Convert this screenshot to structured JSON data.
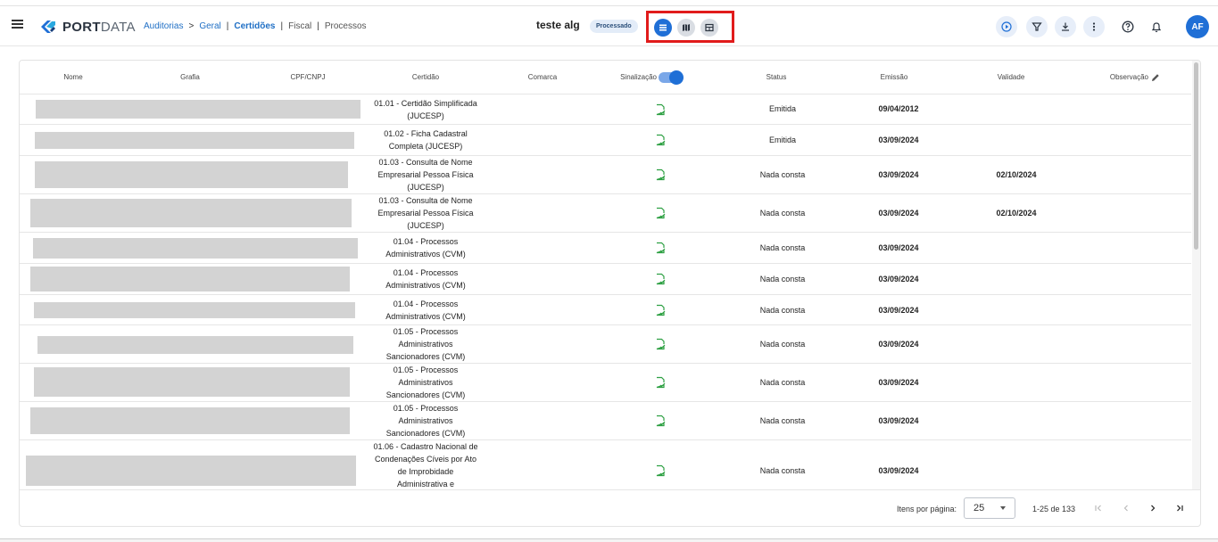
{
  "header": {
    "logo_strong": "PORT",
    "logo_light": "DATA",
    "breadcrumb": [
      {
        "label": "Auditorias"
      },
      {
        "label": ">"
      },
      {
        "label": "Geral"
      },
      {
        "label": "|"
      },
      {
        "label": "Certidões"
      },
      {
        "label": "|"
      },
      {
        "label": "Fiscal"
      },
      {
        "label": "|"
      },
      {
        "label": "Processos"
      }
    ],
    "doc_title": "teste alg",
    "status_chip": "Processado",
    "avatar_initials": "AF",
    "icons": [
      "menu-icon",
      "play-circle-icon",
      "filter-icon",
      "download-icon",
      "more-vert-icon",
      "help-icon",
      "bell-icon"
    ],
    "view_icons": [
      "list-view-icon",
      "map-view-icon",
      "table-view-icon"
    ]
  },
  "table": {
    "columns": {
      "nome": "Nome",
      "grafia": "Grafia",
      "cpf": "CPF/CNPJ",
      "certidao": "Certidão",
      "comarca": "Comarca",
      "sinalizacao": "Sinalização",
      "status": "Status",
      "emissao": "Emissão",
      "validade": "Validade",
      "observacao": "Observação"
    },
    "rows": [
      {
        "cert": "01.01 - Certidão Simplificada (JUCESP)",
        "status": "Emitida",
        "emissao": "09/04/2012",
        "validade": ""
      },
      {
        "cert": "01.02 - Ficha Cadastral Completa (JUCESP)",
        "status": "Emitida",
        "emissao": "03/09/2024",
        "validade": ""
      },
      {
        "cert": "01.03 - Consulta de Nome Empresarial Pessoa Física (JUCESP)",
        "status": "Nada consta",
        "emissao": "03/09/2024",
        "validade": "02/10/2024"
      },
      {
        "cert": "01.03 - Consulta de Nome Empresarial Pessoa Física (JUCESP)",
        "status": "Nada consta",
        "emissao": "03/09/2024",
        "validade": "02/10/2024"
      },
      {
        "cert": "01.04 - Processos Administrativos (CVM)",
        "status": "Nada consta",
        "emissao": "03/09/2024",
        "validade": ""
      },
      {
        "cert": "01.04 - Processos Administrativos (CVM)",
        "status": "Nada consta",
        "emissao": "03/09/2024",
        "validade": ""
      },
      {
        "cert": "01.04 - Processos Administrativos (CVM)",
        "status": "Nada consta",
        "emissao": "03/09/2024",
        "validade": ""
      },
      {
        "cert": "01.05 - Processos Administrativos Sancionadores (CVM)",
        "status": "Nada consta",
        "emissao": "03/09/2024",
        "validade": ""
      },
      {
        "cert": "01.05 - Processos Administrativos Sancionadores (CVM)",
        "status": "Nada consta",
        "emissao": "03/09/2024",
        "validade": ""
      },
      {
        "cert": "01.05 - Processos Administrativos Sancionadores (CVM)",
        "status": "Nada consta",
        "emissao": "03/09/2024",
        "validade": ""
      },
      {
        "cert": "01.06 - Cadastro Nacional de Condenações Cíveis por Ato de Improbidade Administrativa e",
        "status": "Nada consta",
        "emissao": "03/09/2024",
        "validade": ""
      }
    ]
  },
  "paginator": {
    "label": "Itens por página:",
    "page_size": "25",
    "range": "1-25 de 133"
  },
  "colors": {
    "accent": "#1f6fd6",
    "doc_icon": "#2ea043",
    "highlight": "#e11b1b"
  }
}
